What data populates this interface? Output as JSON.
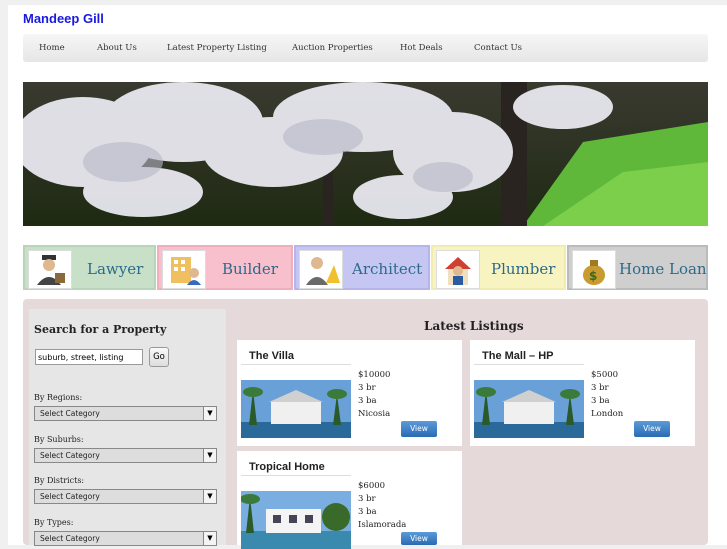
{
  "site": {
    "title": "Mandeep Gill"
  },
  "nav": {
    "items": [
      "Home",
      "About Us",
      "Latest Property Listing",
      "Auction Properties",
      "Hot Deals",
      "Contact Us"
    ]
  },
  "services": [
    {
      "label": "Lawyer",
      "bg": "#c8e0c8",
      "icon": "lawyer-icon"
    },
    {
      "label": "Builder",
      "bg": "#f7c0cc",
      "icon": "builder-icon"
    },
    {
      "label": "Architect",
      "bg": "#c6c6f2",
      "icon": "architect-icon"
    },
    {
      "label": "Plumber",
      "bg": "#f8f4c2",
      "icon": "plumber-icon"
    },
    {
      "label": "Home Loan",
      "bg": "#cfcfcf",
      "icon": "money-bag-icon"
    }
  ],
  "search": {
    "title": "Search for a Property",
    "placeholder": "suburb, street, listing",
    "go_label": "Go",
    "filters": [
      {
        "label": "By Regions:",
        "selected": "Select Category"
      },
      {
        "label": "By Suburbs:",
        "selected": "Select Category"
      },
      {
        "label": "By Districts:",
        "selected": "Select Category"
      },
      {
        "label": "By Types:",
        "selected": "Select Category"
      }
    ]
  },
  "listings": {
    "title": "Latest Listings",
    "view_label": "View",
    "items": [
      {
        "name": "The Villa",
        "price": "$10000",
        "beds": "3 br",
        "baths": "3 ba",
        "location": "Nicosia"
      },
      {
        "name": "The Mall – HP",
        "price": "$5000",
        "beds": "3 br",
        "baths": "3 ba",
        "location": "London"
      },
      {
        "name": "Tropical Home",
        "price": "$6000",
        "beds": "3 br",
        "baths": "3 ba",
        "location": "Islamorada"
      }
    ]
  },
  "colors": {
    "title_blue": "#1a1adf",
    "service_text": "#2d6a8a",
    "content_bg": "#e5d9da",
    "button_blue": "#2a6ab4"
  }
}
